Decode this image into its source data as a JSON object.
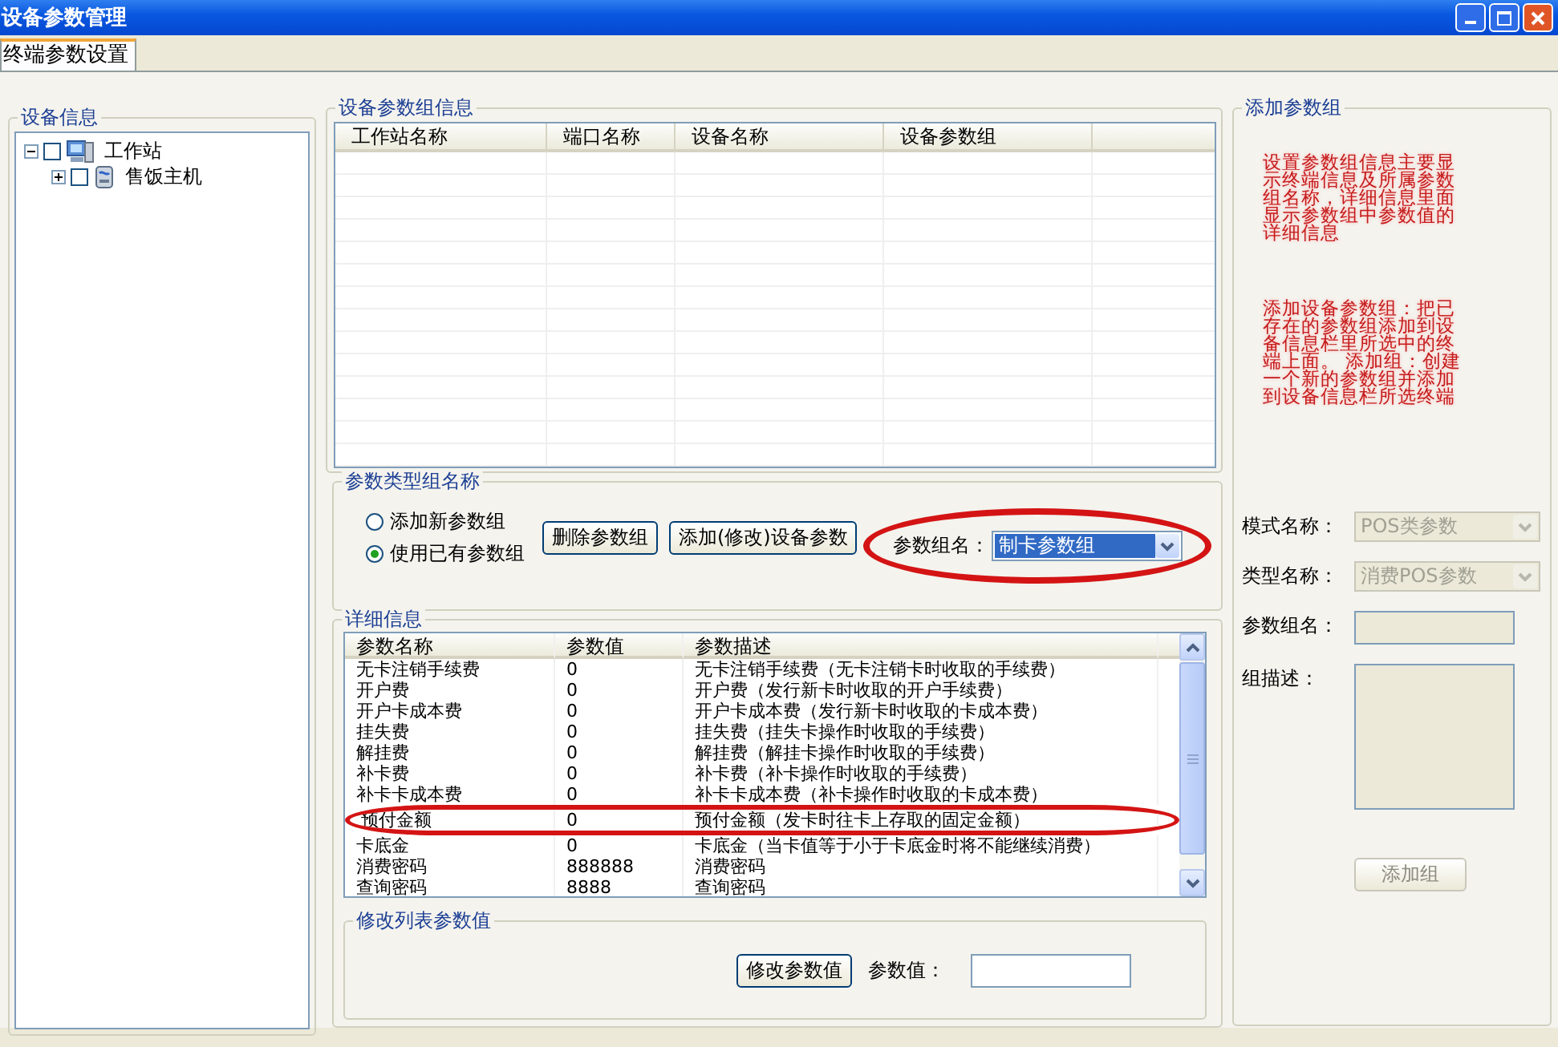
{
  "window": {
    "title": "设备参数管理"
  },
  "tabs": [
    {
      "label": "终端参数设置",
      "selected": true
    }
  ],
  "device_info": {
    "title": "设备信息",
    "tree": [
      {
        "label": "工作站",
        "expanded": true,
        "checked": false,
        "kind": "station",
        "children": [
          {
            "label": "售饭主机",
            "expanded": false,
            "checked": false,
            "kind": "host"
          }
        ]
      }
    ]
  },
  "group_info": {
    "title": "设备参数组信息",
    "columns": [
      "工作站名称",
      "端口名称",
      "设备名称",
      "设备参数组"
    ]
  },
  "type_group": {
    "title": "参数类型组名称",
    "options": [
      {
        "label": "添加新参数组",
        "selected": false
      },
      {
        "label": "使用已有参数组",
        "selected": true
      }
    ],
    "buttons": [
      "删除参数组",
      "添加(修改)设备参数"
    ],
    "group_name_label": "参数组名：",
    "group_name_value": "制卡参数组",
    "group_name_circled": true
  },
  "details": {
    "title": "详细信息",
    "columns": [
      "参数名称",
      "参数值",
      "参数描述"
    ],
    "rows": [
      {
        "cells": [
          "无卡注销手续费",
          "0",
          "无卡注销手续费（无卡注销卡时收取的手续费）"
        ],
        "circled": false
      },
      {
        "cells": [
          "开户费",
          "0",
          "开户费（发行新卡时收取的开户手续费）"
        ],
        "circled": false
      },
      {
        "cells": [
          "开户卡成本费",
          "0",
          "开户卡成本费（发行新卡时收取的卡成本费）"
        ],
        "circled": false
      },
      {
        "cells": [
          "挂失费",
          "0",
          "挂失费（挂失卡操作时收取的手续费）"
        ],
        "circled": false
      },
      {
        "cells": [
          "解挂费",
          "0",
          "解挂费（解挂卡操作时收取的手续费）"
        ],
        "circled": false
      },
      {
        "cells": [
          "补卡费",
          "0",
          "补卡费（补卡操作时收取的手续费）"
        ],
        "circled": false
      },
      {
        "cells": [
          "补卡卡成本费",
          "0",
          "补卡卡成本费（补卡操作时收取的卡成本费）"
        ],
        "circled": false
      },
      {
        "cells": [
          "预付金额",
          "0",
          "预付金额（发卡时往卡上存取的固定金额）"
        ],
        "circled": true
      },
      {
        "cells": [
          "卡底金",
          "0",
          "卡底金（当卡值等于小于卡底金时将不能继续消费）"
        ],
        "circled": false
      },
      {
        "cells": [
          "消费密码",
          "888888",
          "消费密码"
        ],
        "circled": false
      },
      {
        "cells": [
          "查询密码",
          "8888",
          "查询密码"
        ],
        "circled": false
      }
    ]
  },
  "modify": {
    "title": "修改列表参数值",
    "button": "修改参数值",
    "value_label": "参数值："
  },
  "add_group": {
    "title": "添加参数组",
    "notes": [
      "设置参数组信息主要显示终端信息及所属参数组名称，详细信息里面显示参数组中参数值的详细信息",
      "添加设备参数组：把已存在的参数组添加到设备信息栏里所选中的终端上面。 添加组：创建一个新的参数组并添加到设备信息栏所选终端"
    ],
    "fields": [
      {
        "kind": "select",
        "label": "模式名称：",
        "value": "POS类参数",
        "disabled": true
      },
      {
        "kind": "select",
        "label": "类型名称：",
        "value": "消费POS参数",
        "disabled": true
      },
      {
        "kind": "input",
        "label": "参数组名：",
        "disabled": true
      },
      {
        "kind": "textarea",
        "label": "组描述：",
        "disabled": true
      }
    ],
    "button": {
      "label": "添加组",
      "disabled": true
    }
  }
}
